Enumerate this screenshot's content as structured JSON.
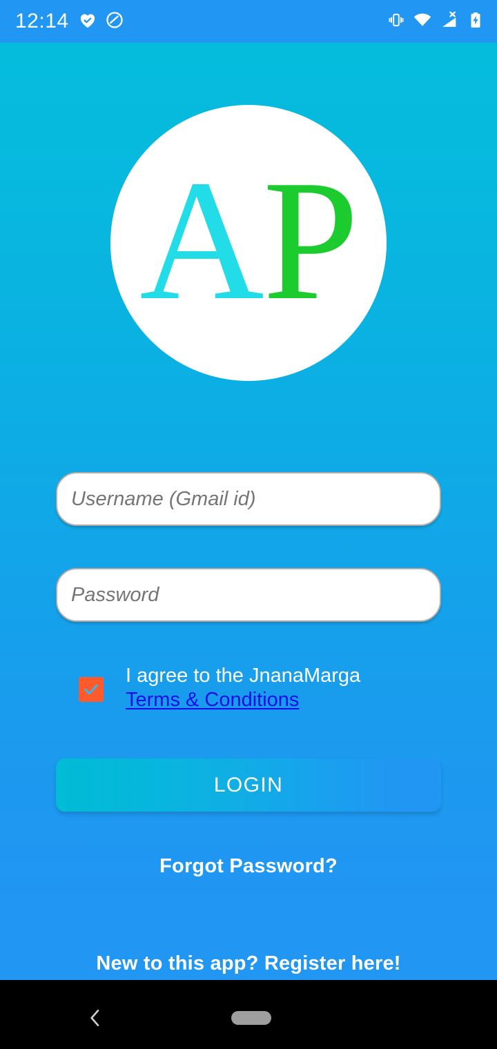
{
  "status_bar": {
    "time": "12:14",
    "left_icons": [
      "heart-check-icon",
      "do-not-disturb-icon"
    ],
    "right_icons": [
      "vibrate-icon",
      "wifi-icon",
      "no-sim-signal-icon",
      "battery-charging-icon"
    ],
    "background_color": "#2196f3"
  },
  "screen": {
    "background_top_color": "#05bcdd",
    "background_bottom_color": "#2196f3"
  },
  "logo": {
    "letter_a": "A",
    "letter_p": "P",
    "letter_a_color": "#22dde8",
    "letter_p_color": "#1ccc2e",
    "circle_color": "#ffffff"
  },
  "form": {
    "username": {
      "value": "",
      "placeholder": "Username (Gmail id)"
    },
    "password": {
      "value": "",
      "placeholder": "Password"
    }
  },
  "terms": {
    "checked": true,
    "checkbox_color": "#ff5a2b",
    "agree_text": "I agree to the JnanaMarga",
    "link_text": "Terms & Conditions",
    "link_color": "#1a0fe8"
  },
  "login_button": {
    "label": "LOGIN",
    "gradient_start": "#00bcd4",
    "gradient_end": "#2196f3"
  },
  "links": {
    "forgot_password": "Forgot Password?",
    "register": "New to this app? Register here!"
  },
  "nav_bar": {
    "back_icon": "chevron-left-icon",
    "home_pill": "home-pill-handle",
    "background_color": "#000000"
  }
}
